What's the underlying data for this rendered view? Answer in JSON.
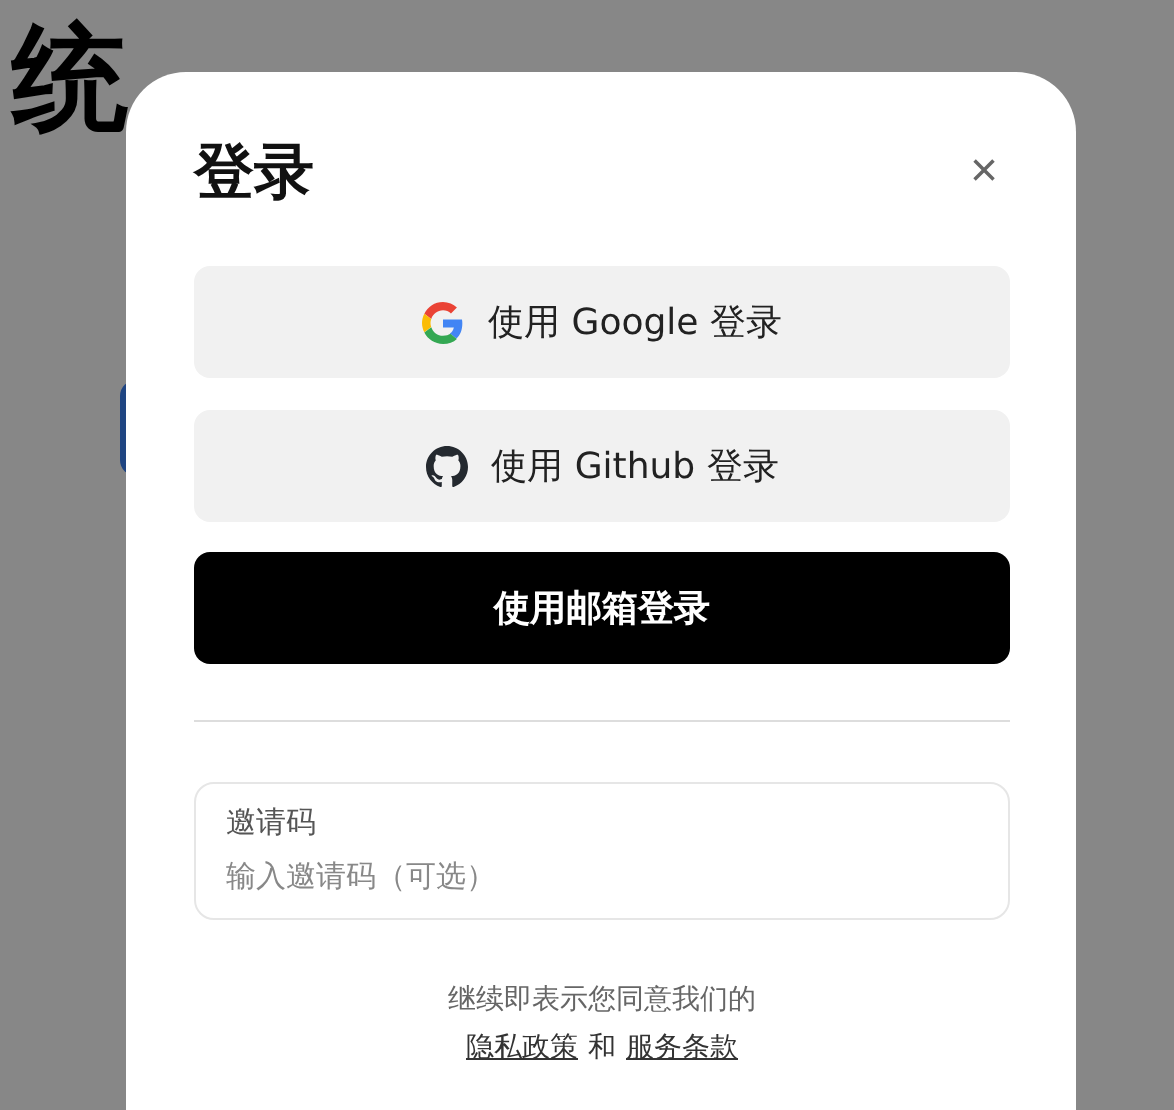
{
  "background": {
    "heading": "统"
  },
  "dialog": {
    "title": "登录",
    "close": "×",
    "buttons": [
      {
        "kind": "google",
        "label": "使用 Google 登录"
      },
      {
        "kind": "github",
        "label": "使用 Github 登录"
      },
      {
        "kind": "email",
        "label": "使用邮箱登录"
      }
    ],
    "invite": {
      "label": "邀请码",
      "placeholder": "输入邀请码（可选）"
    },
    "footer": {
      "text": "继续即表示您同意我们的",
      "privacy": "隐私政策",
      "joiner": "和",
      "terms": "服务条款"
    }
  }
}
